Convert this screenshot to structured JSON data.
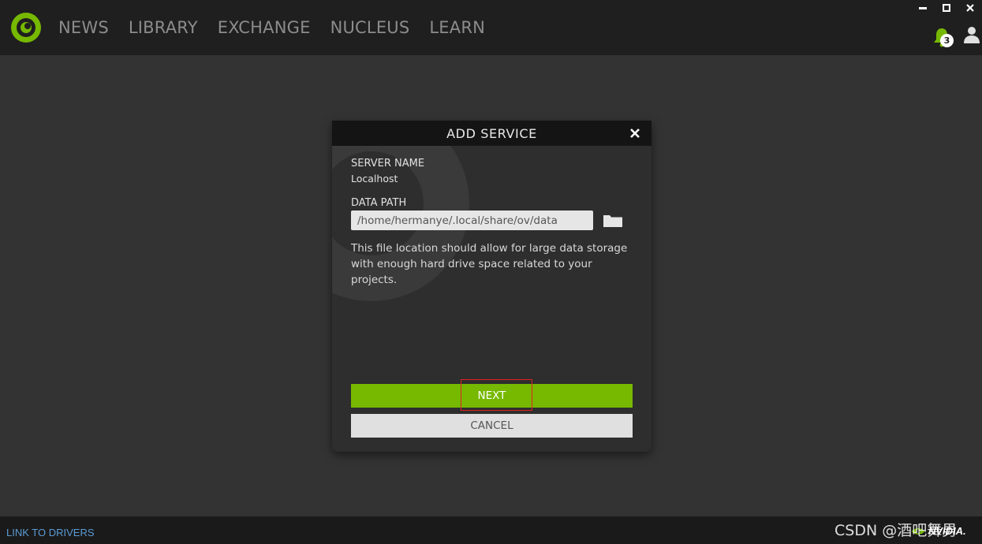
{
  "nav": {
    "items": [
      "NEWS",
      "LIBRARY",
      "EXCHANGE",
      "NUCLEUS",
      "LEARN"
    ]
  },
  "notifications": {
    "count": "3"
  },
  "dialog": {
    "title": "ADD SERVICE",
    "server_name_label": "SERVER NAME",
    "server_name_value": "Localhost",
    "data_path_label": "DATA PATH",
    "data_path_value": "/home/hermanye/.local/share/ov/data",
    "description": "This file location should allow for large data storage with enough hard drive space related to your projects.",
    "next_label": "NEXT",
    "cancel_label": "CANCEL"
  },
  "footer": {
    "link_drivers": "LINK TO DRIVERS",
    "brand": "NVIDIA."
  },
  "watermark": "CSDN @酒吧舞男",
  "colors": {
    "accent": "#76b900",
    "topbar": "#1f1f1f",
    "background": "#333333",
    "highlight": "#e02020"
  },
  "icons": {
    "logo": "omniverse-logo-icon",
    "bell": "bell-icon",
    "user": "user-icon",
    "close": "close-icon",
    "folder": "folder-icon",
    "minimize": "minimize-icon",
    "maximize": "maximize-icon",
    "window_close": "window-close-icon"
  }
}
